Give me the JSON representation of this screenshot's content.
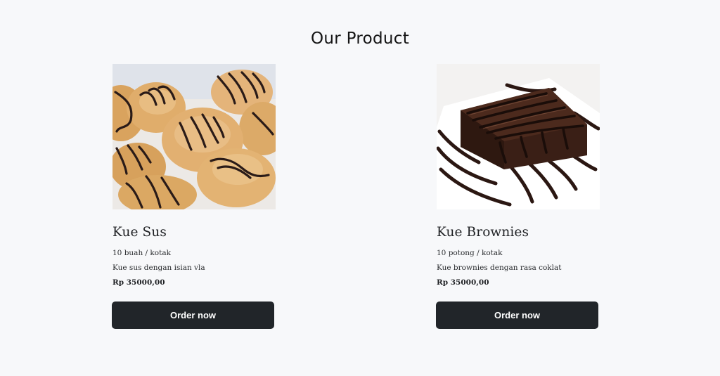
{
  "section": {
    "title": "Our Product"
  },
  "products": [
    {
      "name": "Kue Sus",
      "quantity": "10 buah / kotak",
      "description": "Kue sus dengan isian vla",
      "price": "Rp 35000,00",
      "button_label": "Order now",
      "image": "cream-puff-photo"
    },
    {
      "name": "Kue Brownies",
      "quantity": "10 potong / kotak",
      "description": "Kue brownies dengan rasa coklat",
      "price": "Rp 35000,00",
      "button_label": "Order now",
      "image": "brownie-photo"
    }
  ],
  "colors": {
    "background": "#f7f8fa",
    "button": "#212529",
    "button_text": "#ffffff"
  }
}
